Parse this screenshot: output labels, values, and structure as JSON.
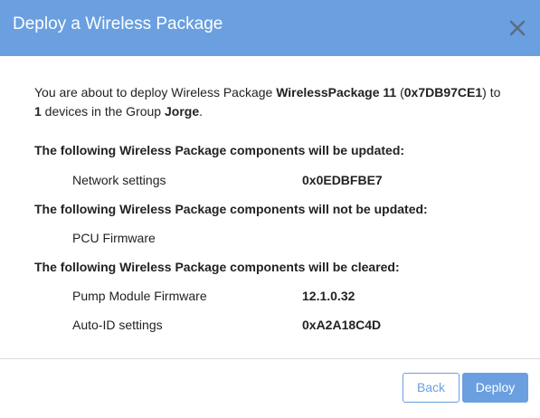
{
  "dialog": {
    "title": "Deploy a Wireless Package",
    "close_icon": "close-icon",
    "intro": {
      "prefix": "You are about to deploy Wireless Package ",
      "package_name": "WirelessPackage 11",
      "open_paren": " (",
      "package_id": "0x7DB97CE1",
      "close_paren_to": ") to",
      "device_count": "1",
      "devices_in_group": " devices in the Group ",
      "group_name": "Jorge",
      "period": "."
    },
    "sections": [
      {
        "title": "The following Wireless Package components will be updated:",
        "items": [
          {
            "name": "Network settings",
            "value": "0x0EDBFBE7"
          }
        ]
      },
      {
        "title": "The following Wireless Package components will not be updated:",
        "items": [
          {
            "name": "PCU Firmware",
            "value": ""
          }
        ]
      },
      {
        "title": "The following Wireless Package components will be cleared:",
        "items": [
          {
            "name": "Pump Module Firmware",
            "value": "12.1.0.32"
          },
          {
            "name": "Auto-ID settings",
            "value": "0xA2A18C4D"
          }
        ]
      }
    ],
    "buttons": {
      "back_label": "Back",
      "deploy_label": "Deploy"
    },
    "colors": {
      "header": "#6a9fe0",
      "accent": "#6a9fe0"
    }
  }
}
